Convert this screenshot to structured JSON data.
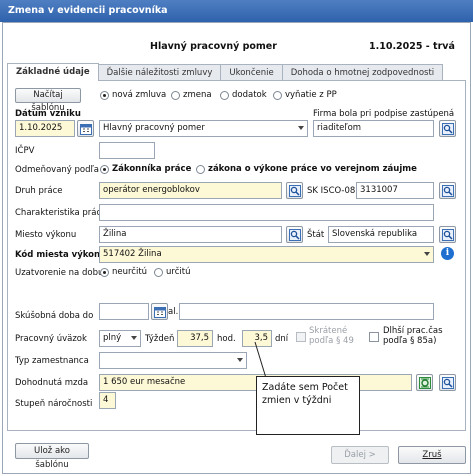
{
  "window": {
    "title": "Zmena v evidencii pracovníka"
  },
  "header": {
    "title": "Hlavný pracovný pomer",
    "date_status": "1.10.2025 - trvá"
  },
  "tabs": [
    {
      "label": "Základné údaje"
    },
    {
      "label": "Ďalšie náležitosti zmluvy"
    },
    {
      "label": "Ukončenie"
    },
    {
      "label": "Dohoda o hmotnej zodpovednosti"
    }
  ],
  "form": {
    "load_template_label": "Načítaj šablónu",
    "contract_options": [
      "nová zmluva",
      "zmena",
      "dodatok",
      "vyňatie z PP"
    ],
    "start_date_label": "Dátum vzniku",
    "start_date": "1.10.2025",
    "contract_type": "Hlavný pracovný pomer",
    "employer_label": "Firma bola pri podpise zastúpená",
    "employer_value": "riaditeľom",
    "icpv_label": "IČPV",
    "icpv_value": "",
    "remuneration_label": "Odmeňovaný podľa",
    "remuneration_options": [
      "Zákonníka práce",
      "zákona o výkone práce vo verejnom záujme"
    ],
    "job_type_label": "Druh práce",
    "job_type": "operátor energoblokov",
    "isco_label": "SK ISCO-08",
    "isco_value": "3131007",
    "job_char_label": "Charakteristika práce",
    "job_char_value": "",
    "place_label": "Miesto výkonu",
    "place_value": "Žilina",
    "state_label": "Štát",
    "state_value": "Slovenská republika",
    "place_code_label": "Kód miesta výkonu",
    "place_code_value": "517402 Žilina",
    "duration_label": "Uzatvorenie na dobu",
    "duration_options": [
      "neurčitú",
      "určitú"
    ],
    "probation_label": "Skúšobná doba do",
    "probation_value": "",
    "probation_al": "al.",
    "workload_label": "Pracovný úväzok",
    "workload_value": "plný",
    "week_label": "Týždeň",
    "week_hours": "37,5",
    "hours_unit": "hod.",
    "days_value": "3,5",
    "days_unit": "dní",
    "shortened_label": "Skrátené podľa § 49",
    "longer_leave_label": "Dlhší prac.čas podľa § 85a)",
    "employee_type_label": "Typ zamestnanca",
    "employee_type_value": "",
    "salary_label": "Dohodnutá mzda",
    "salary_value": "1 650 eur mesačne",
    "difficulty_label": "Stupeň náročnosti",
    "difficulty_value": "4"
  },
  "tooltip": {
    "text": "Zadáte sem Počet zmien v týždni"
  },
  "footer": {
    "save_template_label": "Ulož ako šablónu",
    "next_label": "Ďalej >",
    "cancel_label": "Zruš"
  }
}
